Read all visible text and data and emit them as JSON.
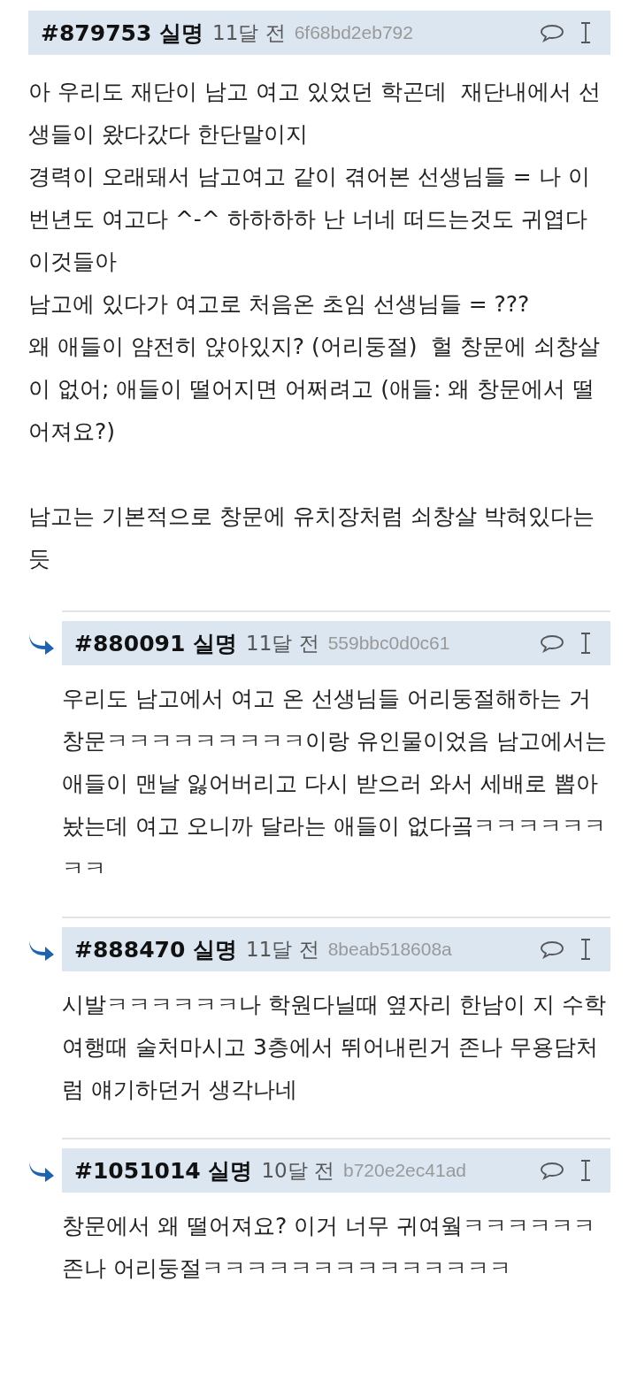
{
  "posts": [
    {
      "kind": "comment",
      "number": "#879753",
      "name": "실명",
      "time": "11달 전",
      "hash": "6f68bd2eb792",
      "blocks": [
        [
          "아 우리도 재단이 남고 여고 있었던 학곤데  재단내에서 선생들이 왔다갔다 한단말이지",
          "경력이 오래돼서 남고여고 같이 겪어본 선생님들 = 나 이번년도 여고다 ^-^ 하하하하 난 너네 떠드는것도 귀엽다 이것들아",
          "남고에 있다가 여고로 처음온 초임 선생님들 = ???",
          "왜 애들이 얌전히 앉아있지? (어리둥절)  헐 창문에 쇠창살이 없어; 애들이 떨어지면 어쩌려고 (애들: 왜 창문에서 떨어져요?)"
        ],
        [
          "남고는 기본적으로 창문에 유치장처럼 쇠창살 박혀있다는듯"
        ]
      ]
    },
    {
      "kind": "reply",
      "number": "#880091",
      "name": "실명",
      "time": "11달 전",
      "hash": "559bbc0d0c61",
      "blocks": [
        [
          "우리도 남고에서 여고 온 선생님들 어리둥절해하는 거 창문ㅋㅋㅋㅋㅋㅋㅋㅋㅋ이랑 유인물이었음 남고에서는 애들이 맨날 잃어버리고 다시 받으러 와서 세배로 뽑아놨는데 여고 오니까 달라는 애들이 없다곸ㅋㅋㅋㅋㅋㅋㅋㅋ"
        ]
      ]
    },
    {
      "kind": "reply",
      "number": "#888470",
      "name": "실명",
      "time": "11달 전",
      "hash": "8beab518608a",
      "blocks": [
        [
          "시발ㅋㅋㅋㅋㅋㅋ나 학원다닐때 옆자리 한남이 지 수학여행때 술처마시고 3층에서 뛰어내린거 존나 무용담처럼 얘기하던거 생각나네"
        ]
      ]
    },
    {
      "kind": "reply",
      "number": "#1051014",
      "name": "실명",
      "time": "10달 전",
      "hash": "b720e2ec41ad",
      "blocks": [
        [
          "창문에서 왜 떨어져요? 이거 너무 귀여웤ㅋㅋㅋㅋㅋㅋ존나 어리둥절ㅋㅋㅋㅋㅋㅋㅋㅋㅋㅋㅋㅋㅋㅋ"
        ]
      ]
    }
  ]
}
